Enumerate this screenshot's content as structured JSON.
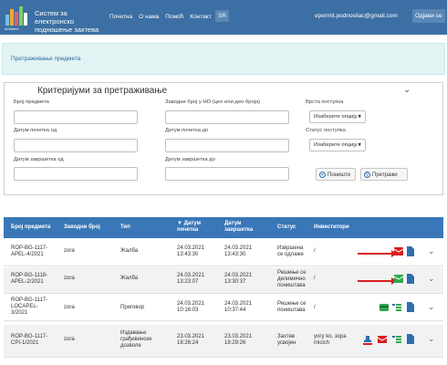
{
  "header": {
    "brand_line1": "Систем за електронско",
    "brand_line2": "подношење захтева",
    "logo_caption": "eZahtevi",
    "nav": [
      "Почетна",
      "О нама",
      "Помоћ",
      "Контакт"
    ],
    "lang": "SR",
    "user_email": "epermit.podnosilac@gmail.com",
    "logout": "Одјави се"
  },
  "breadcrumb": "Претраживање предмета",
  "search": {
    "title": "Критеријуми за претраживање",
    "case_number": "Број предмета",
    "delivery_number": "Заводни број у НО (цео или део броја)",
    "procedure_type": "Врста поступка",
    "procedure_placeholder": "Изаберите опцију...",
    "start_from": "Датум почетка од",
    "start_to": "Датум почетка до",
    "status": "Статус поступка",
    "status_placeholder": "Изаберите опцију...",
    "end_from": "Датум завршетка од",
    "end_to": "Датум завршетка до",
    "reset": "Поништи",
    "search_btn": "Претражи"
  },
  "table": {
    "headers": {
      "number": "Број предмета",
      "delivery": "Заводни број",
      "type": "Тип",
      "start_sort": "▼ Датум",
      "start": "почетка",
      "end1": "Датум",
      "end2": "завршетка",
      "status": "Статус",
      "investors": "Инвеститори"
    },
    "rows": [
      {
        "n1": "ROP-BG-1117-",
        "n2": "APEL-4/2021",
        "delivery": "zora",
        "t1": "Жалба",
        "t2": "",
        "sd": "24.03.2021",
        "st": "13:43:30",
        "ed": "24.03.2021",
        "et": "13:43:30",
        "s1": "Извршена",
        "s2": "се одлаже",
        "inv1": "/",
        "inv2": ""
      },
      {
        "n1": "ROP-BG-1118-",
        "n2": "APEL-2/2021",
        "delivery": "zora",
        "t1": "Жалба",
        "t2": "",
        "sd": "24.03.2021",
        "st": "13:23:07",
        "ed": "24.03.2021",
        "et": "13:30:37",
        "s1": "Решење се",
        "s2": "делимично",
        "s3": "поништава",
        "inv1": "/",
        "inv2": ""
      },
      {
        "n1": "ROP-BG-1117-",
        "n2": "LOCAPEL-",
        "n3": "3/2021",
        "delivery": "zora",
        "t1": "Приговор",
        "t2": "",
        "sd": "24.03.2021",
        "st": "10:16:03",
        "ed": "24.03.2021",
        "et": "10:37:44",
        "s1": "Решење се",
        "s2": "поништава",
        "inv1": "/",
        "inv2": ""
      },
      {
        "n1": "ROP-BG-1117-",
        "n2": "CPI-1/2021",
        "delivery": "zora",
        "t1": "Издавање",
        "t2": "грађевинске",
        "t3": "дозволе",
        "sd": "23.03.2021",
        "st": "18:26:24",
        "ed": "23.03.2021",
        "et": "18:29:26",
        "s1": "Захтев",
        "s2": "усвојен",
        "inv1": "yoгy ko, зорa",
        "inv2": "micich"
      }
    ]
  },
  "colors": {
    "header": "#3c6fa3",
    "table_header": "#3a77b8",
    "alert": "#d62020"
  }
}
